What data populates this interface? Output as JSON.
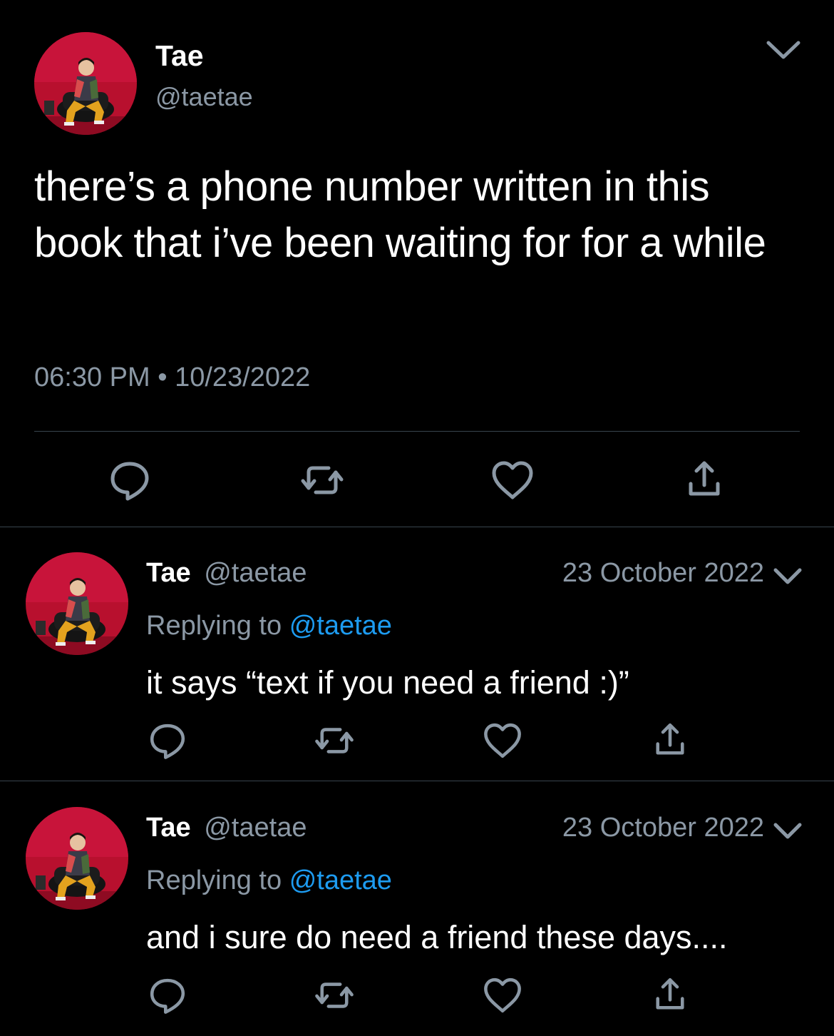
{
  "main": {
    "author_name": "Tae",
    "author_handle": "@taetae",
    "text": "there’s a phone number written in this book that i’ve been waiting for for a while",
    "time": "06:30 PM",
    "separator": "•",
    "date": "10/23/2022"
  },
  "replies": [
    {
      "author_name": "Tae",
      "author_handle": "@taetae",
      "date": "23 October 2022",
      "replying_prefix": "Replying to",
      "replying_to": "@taetae",
      "text": "it says “text if you need a friend :)”"
    },
    {
      "author_name": "Tae",
      "author_handle": "@taetae",
      "date": "23 October 2022",
      "replying_prefix": "Replying to",
      "replying_to": "@taetae",
      "text": "and i sure do need a friend these days...."
    }
  ],
  "colors": {
    "background": "#000000",
    "text_primary": "#ffffff",
    "text_secondary": "#8b98a5",
    "link": "#1d9bf0",
    "divider": "#38444d"
  },
  "icons": [
    "reply-icon",
    "retweet-icon",
    "like-icon",
    "share-icon",
    "chevron-down-icon"
  ]
}
